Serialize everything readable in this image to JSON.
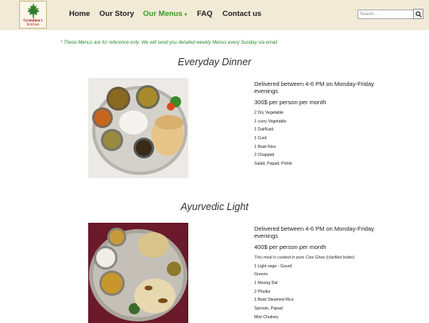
{
  "brand": {
    "line1": "Grandma's",
    "line2": "Kitchen",
    "logo_icon": "maple-leaf-icon"
  },
  "nav": {
    "home": "Home",
    "our_story": "Our Story",
    "our_menus": "Our Menus",
    "menus_caret": "▾",
    "faq": "FAQ",
    "contact": "Contact us"
  },
  "search": {
    "placeholder": "Search...",
    "button_icon": "search-icon"
  },
  "notice": "* These Menus are for reference only. We will send you detailed weekly Menus every Sunday via email",
  "menus": [
    {
      "title": "Everyday Dinner",
      "delivery": "Delivered between 4-6 PM on Monday-Friday evenings",
      "price": "300$ per person per month",
      "items": [
        "2 Dry Vegetable",
        "1 curry Vegetable",
        "1 Dal/Kadi",
        "1 Curd",
        "1 Bowl Rice",
        "2 Chappati",
        "Salad, Papad, Pickle"
      ]
    },
    {
      "title": "Ayurvedic Light",
      "delivery": "Delivered between 4-6 PM on Monday-Friday evenings",
      "price": "400$ per person per month",
      "note": "This meal is cooked in pure Cow Ghee (clarified butter)",
      "items": [
        "1 Light vege - Gourd",
        "Greens",
        "1 Moong Dal",
        "2 Phulka",
        "1 Bowl Steamed Rice",
        "Sprouts, Papad",
        "Mint Chutney"
      ]
    }
  ],
  "colors": {
    "header_bg": "#f1ead7",
    "active_nav": "#3a9a2a",
    "notice": "#2a8a2a",
    "brand_red": "#a0191c"
  }
}
